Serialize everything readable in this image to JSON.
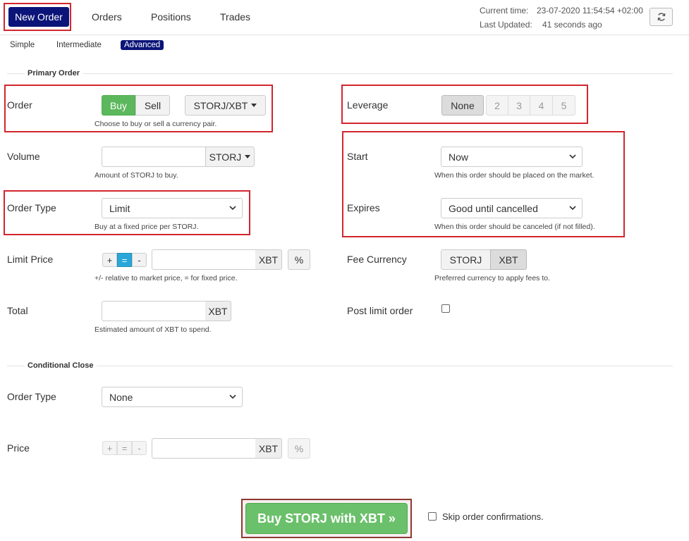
{
  "nav": {
    "new_order": "New Order",
    "orders": "Orders",
    "positions": "Positions",
    "trades": "Trades"
  },
  "status": {
    "current_time_label": "Current time:",
    "current_time_value": "23-07-2020 11:54:54 +02:00",
    "last_updated_label": "Last Updated:",
    "last_updated_value": "41 seconds ago"
  },
  "modes": {
    "simple": "Simple",
    "intermediate": "Intermediate",
    "advanced": "Advanced"
  },
  "primary": {
    "title": "Primary Order",
    "order_label": "Order",
    "buy": "Buy",
    "sell": "Sell",
    "pair": "STORJ/XBT",
    "order_help": "Choose to buy or sell a currency pair.",
    "volume_label": "Volume",
    "volume_value": "",
    "volume_unit": "STORJ",
    "volume_help": "Amount of STORJ to buy.",
    "order_type_label": "Order Type",
    "order_type_value": "Limit",
    "order_type_help": "Buy at a fixed price per STORJ.",
    "limit_price_label": "Limit Price",
    "plus": "+",
    "equals": "=",
    "minus": "-",
    "limit_price_value": "",
    "limit_price_unit": "XBT",
    "percent": "%",
    "limit_price_help": "+/- relative to market price, = for fixed price.",
    "total_label": "Total",
    "total_value": "",
    "total_unit": "XBT",
    "total_help": "Estimated amount of XBT to spend."
  },
  "right": {
    "leverage_label": "Leverage",
    "leverage_options": [
      "None",
      "2",
      "3",
      "4",
      "5"
    ],
    "start_label": "Start",
    "start_value": "Now",
    "start_help": "When this order should be placed on the market.",
    "expires_label": "Expires",
    "expires_value": "Good until cancelled",
    "expires_help": "When this order should be canceled (if not filled).",
    "fee_label": "Fee Currency",
    "fee_storj": "STORJ",
    "fee_xbt": "XBT",
    "fee_help": "Preferred currency to apply fees to.",
    "post_limit_label": "Post limit order"
  },
  "conditional": {
    "title": "Conditional Close",
    "order_type_label": "Order Type",
    "order_type_value": "None",
    "price_label": "Price",
    "plus": "+",
    "equals": "=",
    "minus": "-",
    "price_value": "",
    "price_unit": "XBT",
    "percent": "%"
  },
  "footer": {
    "submit": "Buy STORJ with XBT »",
    "skip_label": "Skip order confirmations."
  },
  "colors": {
    "brand_navy": "#0b1478",
    "buy_green": "#5cb85c",
    "highlight_red": "#d2262e",
    "active_blue": "#2aa7d8"
  },
  "icons": {
    "refresh": "refresh-icon",
    "chevron": "chevron-down-icon",
    "caret": "caret-down-icon"
  }
}
